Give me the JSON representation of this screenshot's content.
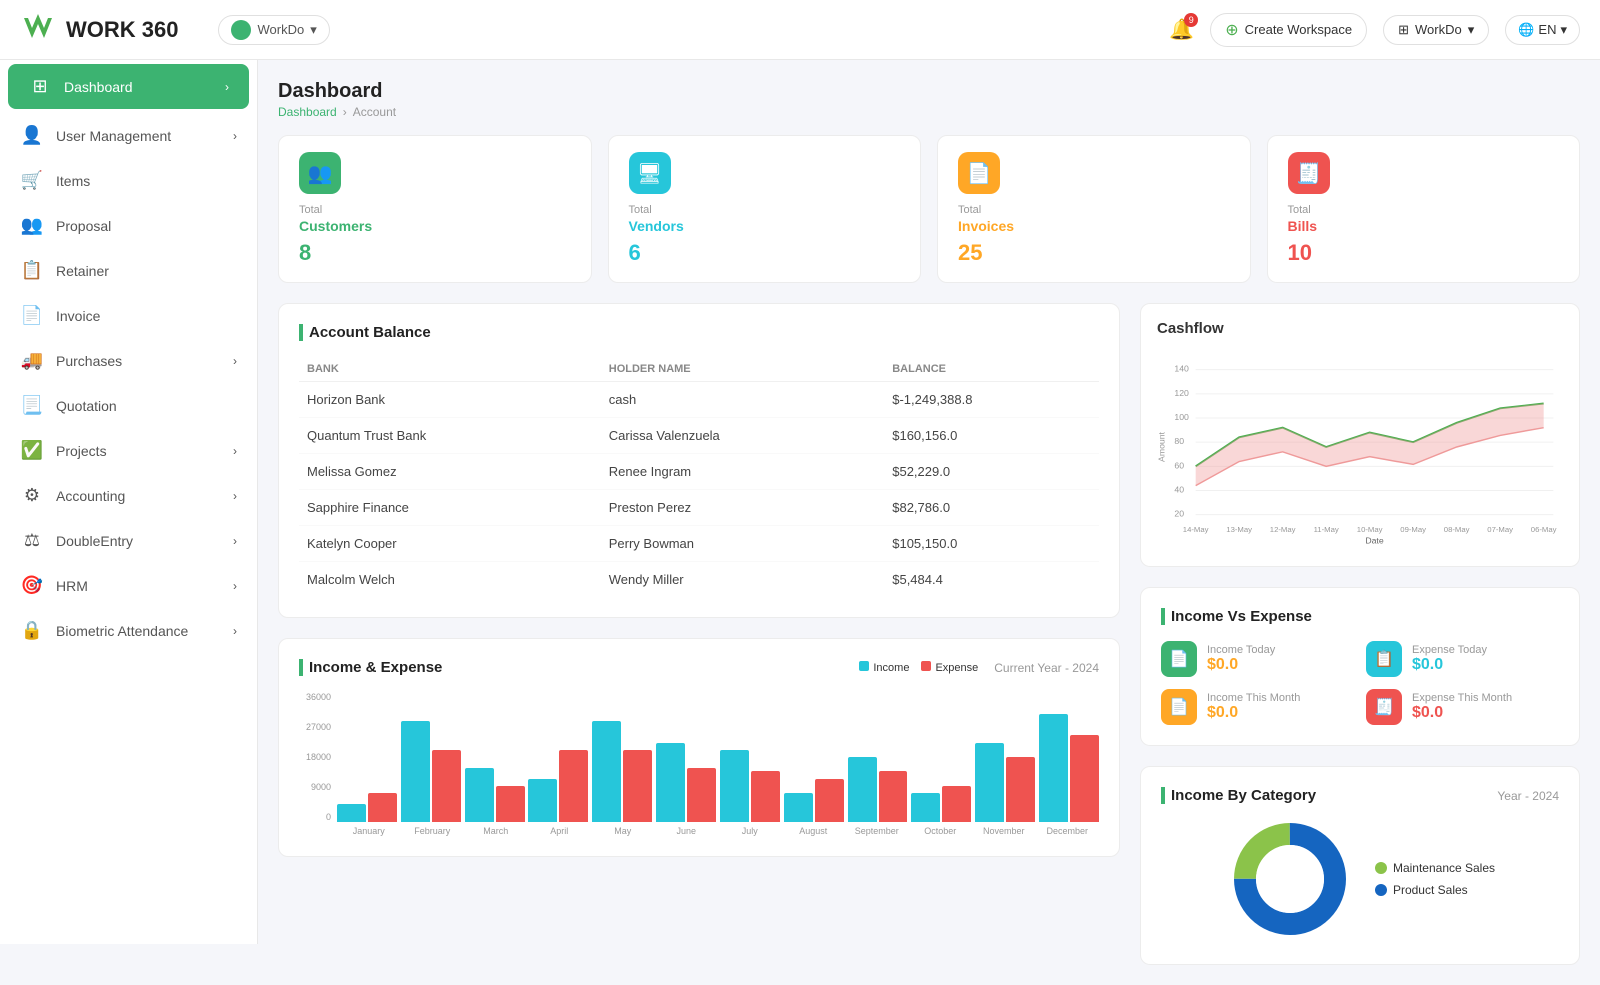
{
  "navbar": {
    "logo": "WORK 360",
    "workspace": "WorkDo",
    "create_workspace": "Create Workspace",
    "workdo_btn": "WorkDo",
    "lang": "EN",
    "notif_count": "9"
  },
  "sidebar": {
    "items": [
      {
        "id": "dashboard",
        "label": "Dashboard",
        "icon": "⊞",
        "active": true,
        "arrow": true
      },
      {
        "id": "user-management",
        "label": "User Management",
        "icon": "👤",
        "active": false,
        "arrow": true
      },
      {
        "id": "items",
        "label": "Items",
        "icon": "🛒",
        "active": false,
        "arrow": false
      },
      {
        "id": "proposal",
        "label": "Proposal",
        "icon": "👥",
        "active": false,
        "arrow": false
      },
      {
        "id": "retainer",
        "label": "Retainer",
        "icon": "📋",
        "active": false,
        "arrow": false
      },
      {
        "id": "invoice",
        "label": "Invoice",
        "icon": "📄",
        "active": false,
        "arrow": false
      },
      {
        "id": "purchases",
        "label": "Purchases",
        "icon": "🚚",
        "active": false,
        "arrow": true
      },
      {
        "id": "quotation",
        "label": "Quotation",
        "icon": "📃",
        "active": false,
        "arrow": false
      },
      {
        "id": "projects",
        "label": "Projects",
        "icon": "✅",
        "active": false,
        "arrow": true
      },
      {
        "id": "accounting",
        "label": "Accounting",
        "icon": "⚙",
        "active": false,
        "arrow": true
      },
      {
        "id": "double-entry",
        "label": "DoubleEntry",
        "icon": "⚖",
        "active": false,
        "arrow": true
      },
      {
        "id": "hrm",
        "label": "HRM",
        "icon": "🎯",
        "active": false,
        "arrow": true
      },
      {
        "id": "biometric",
        "label": "Biometric Attendance",
        "icon": "🔒",
        "active": false,
        "arrow": true
      }
    ]
  },
  "breadcrumb": {
    "dashboard": "Dashboard",
    "account": "Account"
  },
  "page_title": "Dashboard",
  "summary_cards": [
    {
      "id": "customers",
      "label": "Total",
      "name": "Customers",
      "value": "8",
      "color": "#3cb371",
      "icon": "👥"
    },
    {
      "id": "vendors",
      "label": "Total",
      "name": "Vendors",
      "value": "6",
      "color": "#26c6da",
      "icon": "🖥"
    },
    {
      "id": "invoices",
      "label": "Total",
      "name": "Invoices",
      "value": "25",
      "color": "#ffa726",
      "icon": "📄"
    },
    {
      "id": "bills",
      "label": "Total",
      "name": "Bills",
      "value": "10",
      "color": "#ef5350",
      "icon": "🧾"
    }
  ],
  "account_balance": {
    "title": "Account Balance",
    "columns": [
      "BANK",
      "HOLDER NAME",
      "BALANCE"
    ],
    "rows": [
      {
        "bank": "Horizon Bank",
        "holder": "cash",
        "balance": "$-1,249,388.8"
      },
      {
        "bank": "Quantum Trust Bank",
        "holder": "Carissa Valenzuela",
        "balance": "$160,156.0"
      },
      {
        "bank": "Melissa Gomez",
        "holder": "Renee Ingram",
        "balance": "$52,229.0"
      },
      {
        "bank": "Sapphire Finance",
        "holder": "Preston Perez",
        "balance": "$82,786.0"
      },
      {
        "bank": "Katelyn Cooper",
        "holder": "Perry Bowman",
        "balance": "$105,150.0"
      },
      {
        "bank": "Malcolm Welch",
        "holder": "Wendy Miller",
        "balance": "$5,484.4"
      }
    ]
  },
  "cashflow": {
    "title": "Cashflow",
    "y_labels": [
      "140",
      "120",
      "100",
      "80",
      "60",
      "40",
      "20"
    ],
    "x_labels": [
      "14-May",
      "13-May",
      "12-May",
      "11-May",
      "10-May",
      "09-May",
      "08-May",
      "07-May",
      "06-May"
    ],
    "x_axis_label": "Date",
    "y_axis_label": "Amount"
  },
  "income_vs_expense": {
    "title": "Income Vs Expense",
    "income_today_label": "Income Today",
    "income_today_value": "$0.0",
    "expense_today_label": "Expense Today",
    "expense_today_value": "$0.0",
    "income_month_label": "Income This Month",
    "income_month_value": "$0.0",
    "expense_month_label": "Expense This Month",
    "expense_month_value": "$0.0"
  },
  "income_expense_chart": {
    "title": "Income & Expense",
    "period": "Current Year - 2024",
    "income_label": "Income",
    "expense_label": "Expense",
    "y_labels": [
      "36000",
      "27000",
      "18000",
      "9000",
      "0"
    ],
    "months": [
      "January",
      "February",
      "March",
      "April",
      "May",
      "June",
      "July",
      "August",
      "September",
      "October",
      "November",
      "December"
    ],
    "income_data": [
      5,
      28,
      15,
      12,
      28,
      22,
      20,
      8,
      18,
      8,
      22,
      30
    ],
    "expense_data": [
      8,
      20,
      10,
      20,
      20,
      15,
      14,
      12,
      14,
      10,
      18,
      24
    ]
  },
  "income_by_category": {
    "title": "Income By Category",
    "period": "Year - 2024",
    "categories": [
      {
        "name": "Maintenance Sales",
        "color": "#8bc34a",
        "percent": 25
      },
      {
        "name": "Product Sales",
        "color": "#1565c0",
        "percent": 75
      }
    ]
  }
}
